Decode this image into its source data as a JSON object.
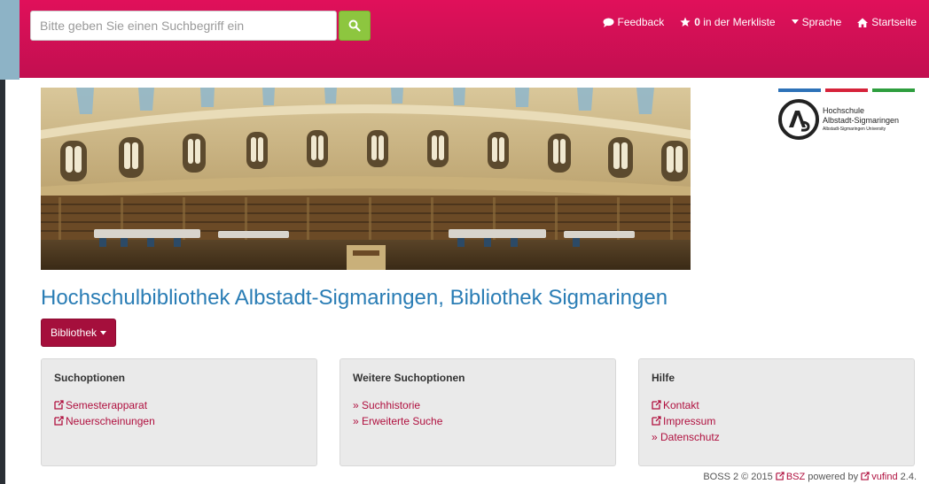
{
  "search": {
    "placeholder": "Bitte geben Sie einen Suchbegriff ein"
  },
  "nav": {
    "feedback": "Feedback",
    "merkliste_count": "0",
    "merkliste_label": " in der Merkliste",
    "sprache": "Sprache",
    "startseite": "Startseite"
  },
  "logo": {
    "line1": "Hochschule",
    "line2": "Albstadt-Sigmaringen",
    "line3": "Albstadt-Sigmaringen University",
    "bar_colors": [
      "#2d72b8",
      "#d6223a",
      "#2e9e3e"
    ]
  },
  "page_title": "Hochschulbibliothek Albstadt-Sigmaringen, Bibliothek Sigmaringen",
  "bibliothek_button": "Bibliothek",
  "panels": [
    {
      "title": "Suchoptionen",
      "links": [
        {
          "label": "Semesterapparat",
          "icon": "external-link-icon"
        },
        {
          "label": "Neuerscheinungen",
          "icon": "external-link-icon"
        }
      ]
    },
    {
      "title": "Weitere Suchoptionen",
      "links": [
        {
          "label": "» Suchhistorie"
        },
        {
          "label": "» Erweiterte Suche"
        }
      ]
    },
    {
      "title": "Hilfe",
      "links": [
        {
          "label": "Kontakt",
          "icon": "external-link-icon"
        },
        {
          "label": "Impressum",
          "icon": "external-link-icon"
        },
        {
          "label": "» Datenschutz"
        }
      ]
    }
  ],
  "footer": {
    "prefix": "BOSS 2 © 2015 ",
    "bsz": "BSZ",
    "middle": " powered by ",
    "vufind": "vufind",
    "suffix": " 2.4."
  },
  "colors": {
    "header": "#d20f55",
    "search_button": "#8dc63f",
    "title": "#2a7db5",
    "link": "#b0103f",
    "bibliothek_button": "#a50f3c"
  }
}
